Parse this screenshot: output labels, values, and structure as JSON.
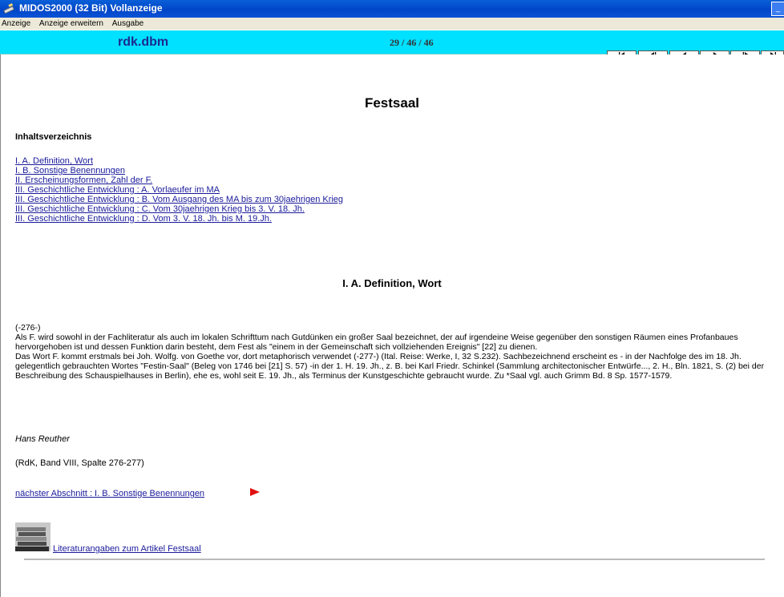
{
  "window": {
    "title": "MIDOS2000 (32 Bit)  Vollanzeige",
    "icon": "app-icon",
    "controls": [
      "minimize"
    ]
  },
  "menu": {
    "items": [
      "Anzeige",
      "Anzeige erweitern",
      "Ausgabe"
    ]
  },
  "navbar": {
    "database": "rdk.dbm",
    "record": "29 / 46 / 46",
    "buttons": [
      "first-icon",
      "prev-page-icon",
      "prev-icon",
      "next-icon",
      "next-page-icon",
      "last-icon"
    ],
    "accent": "#00e0ff"
  },
  "article": {
    "title": "Festsaal",
    "toc_title": "Inhaltsverzeichnis",
    "toc": [
      "I. A. Definition, Wort ",
      "I. B. Sonstige Benennungen ",
      "II. Erscheinungsformen, Zahl der F. ",
      "III. Geschichtliche Entwicklung : A. Vorlaeufer im MA ",
      "III. Geschichtliche Entwicklung : B. Vom Ausgang des MA bis zum 30jaehrigen Krieg ",
      "III. Geschichtliche Entwicklung : C. Vom 30jaehrigen Krieg bis 3. V. 18. Jh. ",
      "III. Geschichtliche Entwicklung : D. Vom 3. V. 18. Jh. bis M. 19.Jh. "
    ],
    "section_title": "I. A. Definition, Wort",
    "paragraphs": [
      "(-276-)",
      "Als F. wird sowohl in der Fachliteratur als auch im lokalen Schrifttum nach Gutdünken ein großer Saal bezeichnet, der auf irgendeine Weise gegenüber den sonstigen Räumen eines Profanbaues hervorgehoben ist und dessen Funktion darin besteht, dem Fest als \"einem in der Gemeinschaft sich vollziehenden Ereignis\" [22] zu dienen.",
      "Das Wort F. kommt erstmals bei Joh. Wolfg. von Goethe vor, dort metaphorisch verwendet (-277-) (Ital. Reise: Werke, I, 32 S.232). Sachbezeichnend erscheint es - in der Nachfolge des im 18. Jh. gelegentlich gebrauchten Wortes \"Festin-Saal\" (Beleg von 1746 bei [21] S. 57) -in der 1. H. 19. Jh., z. B. bei Karl Friedr. Schinkel (Sammlung architectonischer Entwürfe..., 2. H., Bln. 1821, S. (2) bei der Beschreibung des Schauspielhauses in Berlin), ehe es, wohl seit E. 19. Jh., als Terminus der Kunstgeschichte gebraucht wurde. Zu *Saal vgl. auch Grimm Bd. 8 Sp. 1577-1579."
    ],
    "author": "Hans Reuther",
    "source": "(RdK, Band VIII, Spalte 276-277)",
    "next_link": "nächster Abschnitt : I. B. Sonstige Benennungen ",
    "literature_link": "Literaturangaben zum Artikel Festsaal"
  }
}
